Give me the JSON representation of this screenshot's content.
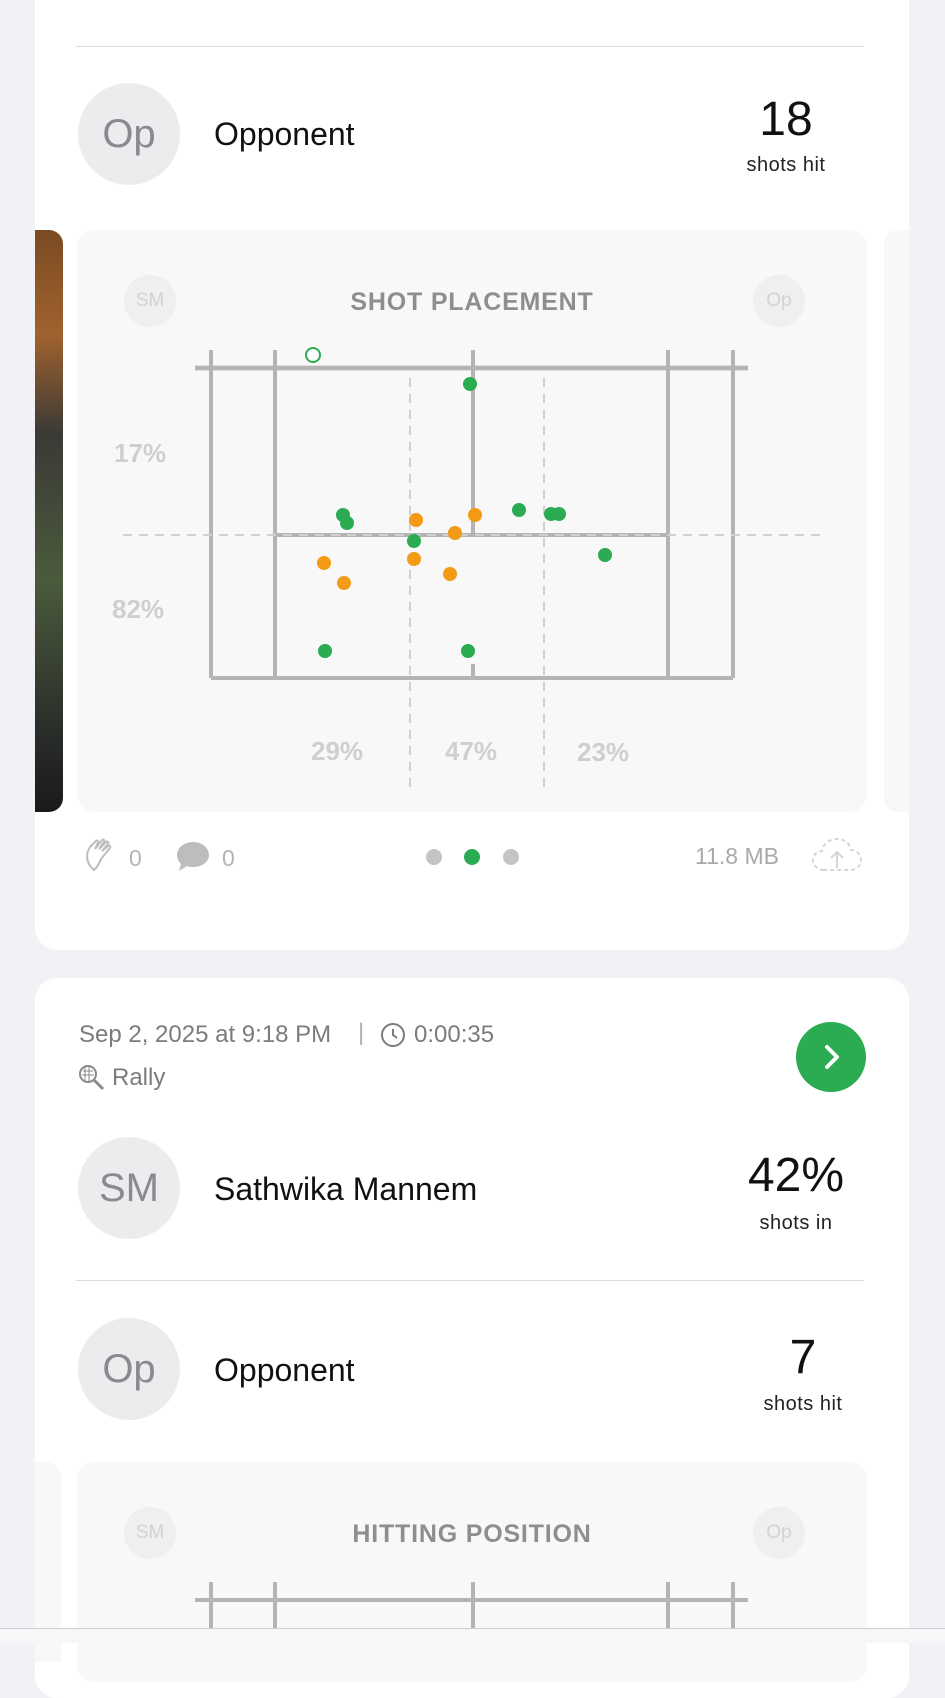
{
  "session1": {
    "opponent": {
      "initials": "Op",
      "name": "Opponent",
      "value": "18",
      "label": "shots hit"
    },
    "panel": {
      "title": "SHOT PLACEMENT",
      "badge_left": "SM",
      "badge_right": "Op",
      "row_pct_top": "17%",
      "row_pct_bottom": "82%",
      "col_pct_left": "29%",
      "col_pct_middle": "47%",
      "col_pct_right": "23%"
    },
    "footer": {
      "claps": "0",
      "comments": "0",
      "size": "11.8 MB",
      "pages": 3,
      "active_page": 2
    },
    "chart_data": {
      "type": "scatter",
      "series": [
        {
          "color": "#2bab52",
          "points": [
            [
              470,
              381
            ],
            [
              343,
              512
            ],
            [
              347,
              520
            ],
            [
              414,
              538
            ],
            [
              519,
              507
            ],
            [
              551,
              511
            ],
            [
              559,
              511
            ],
            [
              605,
              552
            ],
            [
              325,
              648
            ],
            [
              468,
              648
            ]
          ]
        },
        {
          "color": "#f39a16",
          "points": [
            [
              416,
              517
            ],
            [
              475,
              512
            ],
            [
              455,
              530
            ],
            [
              414,
              556
            ],
            [
              450,
              571
            ],
            [
              324,
              560
            ],
            [
              344,
              580
            ]
          ]
        },
        {
          "color": "#2bab52",
          "hollow": true,
          "points": [
            [
              313,
              352
            ]
          ]
        }
      ]
    }
  },
  "session2": {
    "date": "Sep 2, 2025 at 9:18 PM",
    "separator": "|",
    "duration": "0:00:35",
    "mode": "Rally",
    "player": {
      "initials": "SM",
      "name": "Sathwika Mannem",
      "value": "42%",
      "label": "shots in"
    },
    "opponent": {
      "initials": "Op",
      "name": "Opponent",
      "value": "7",
      "label": "shots hit"
    },
    "panel": {
      "title": "HITTING POSITION",
      "badge_left": "SM",
      "badge_right": "Op"
    }
  },
  "colors": {
    "accent_green": "#2bab52",
    "accent_orange": "#f39a16"
  }
}
